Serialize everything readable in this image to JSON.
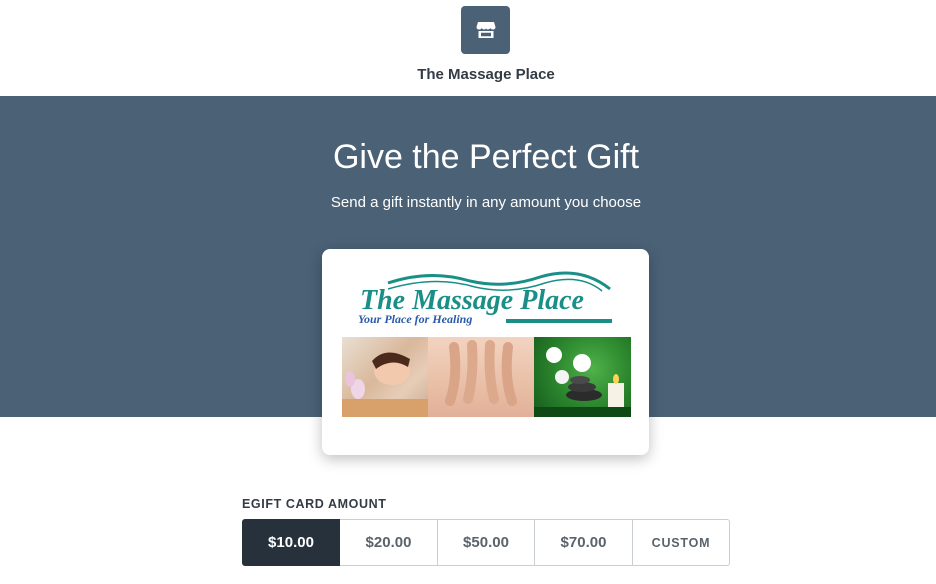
{
  "merchant": {
    "name": "The Massage Place",
    "icon": "storefront-icon"
  },
  "hero": {
    "title": "Give the Perfect Gift",
    "subtitle": "Send a gift instantly in any amount you choose",
    "background_color": "#4b6176"
  },
  "gift_card": {
    "logo_title": "The Massage Place",
    "logo_tagline": "Your Place for Healing",
    "logo_color": "#1a8f87",
    "tagline_color": "#2a5aa8",
    "photos": [
      "massage-face-photo",
      "massage-back-photo",
      "orchid-stones-candle-photo"
    ]
  },
  "amount": {
    "label": "EGIFT CARD AMOUNT",
    "options": [
      "$10.00",
      "$20.00",
      "$50.00",
      "$70.00",
      "CUSTOM"
    ],
    "selected": "$10.00",
    "selected_color": "#27313b"
  }
}
